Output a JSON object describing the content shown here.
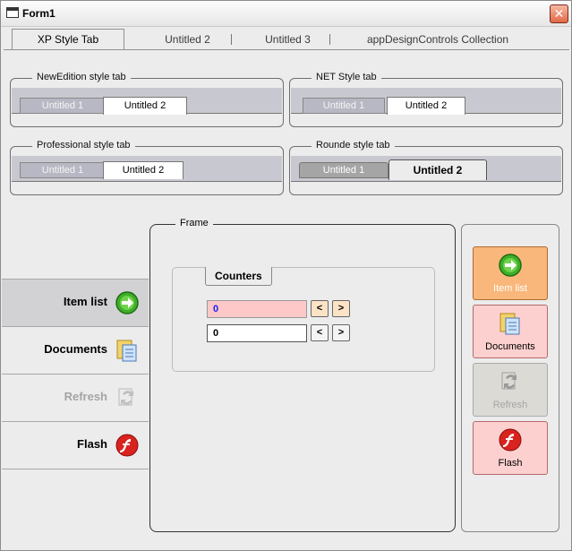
{
  "window": {
    "title": "Form1",
    "close_glyph": "✕",
    "icon": "window-icon"
  },
  "xp_tabs": {
    "items": [
      {
        "label": "XP Style Tab",
        "selected": true
      },
      {
        "label": "Untitled 2",
        "selected": false
      },
      {
        "label": "Untitled 3",
        "selected": false
      },
      {
        "label": "appDesignControls Collection",
        "selected": false
      }
    ]
  },
  "groups": {
    "newedition": {
      "title": "NewEdition style tab",
      "tabs": [
        "Untitled 1",
        "Untitled 2"
      ],
      "selected": 1
    },
    "net": {
      "title": "NET Style tab",
      "tabs": [
        "Untitled 1",
        "Untitled 2"
      ],
      "selected": 1
    },
    "professional": {
      "title": "Professional style tab",
      "tabs": [
        "Untitled 1",
        "Untitled 2"
      ],
      "selected": 1
    },
    "rounde": {
      "title": "Rounde style tab",
      "tabs": [
        "Untitled 1",
        "Untitled 2"
      ],
      "selected": 1
    }
  },
  "nav": {
    "items": [
      {
        "label": "Item list",
        "icon": "green-arrow-icon",
        "selected": true,
        "enabled": true
      },
      {
        "label": "Documents",
        "icon": "documents-icon",
        "selected": false,
        "enabled": true
      },
      {
        "label": "Refresh",
        "icon": "refresh-icon",
        "selected": false,
        "enabled": false
      },
      {
        "label": "Flash",
        "icon": "flash-icon",
        "selected": false,
        "enabled": true
      }
    ]
  },
  "frame": {
    "title": "Frame",
    "counters": {
      "title": "Counters",
      "values": [
        "0",
        "0"
      ],
      "prev_glyph": "<",
      "next_glyph": ">"
    }
  },
  "right_buttons": {
    "items": [
      {
        "label": "Item list",
        "icon": "green-arrow-icon",
        "bg": "#f9b77b",
        "enabled": true
      },
      {
        "label": "Documents",
        "icon": "documents-icon",
        "bg": "#fdd0d0",
        "enabled": true
      },
      {
        "label": "Refresh",
        "icon": "refresh-icon",
        "bg": "#dcdad5",
        "enabled": false
      },
      {
        "label": "Flash",
        "icon": "flash-icon",
        "bg": "#fdd0d0",
        "enabled": true
      }
    ]
  },
  "colors": {
    "counter1_bg": "#ffc8c8",
    "counter1_text": "#1a1aff",
    "counter1_btn_bg": "#fde3c6"
  }
}
